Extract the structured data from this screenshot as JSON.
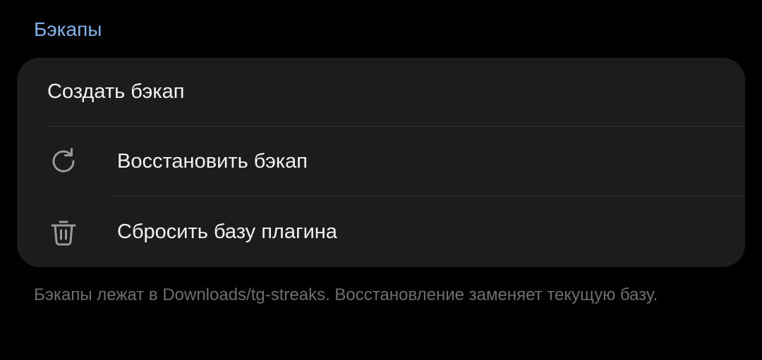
{
  "section": {
    "title": "Бэкапы"
  },
  "items": [
    {
      "label": "Создать бэкап",
      "icon": ""
    },
    {
      "label": "Восстановить бэкап",
      "icon": "refresh-icon"
    },
    {
      "label": "Сбросить базу плагина",
      "icon": "trash-icon"
    }
  ],
  "footer": {
    "note": "Бэкапы лежат в Downloads/tg-streaks. Восстановление заменяет текущую базу."
  },
  "colors": {
    "background": "#000000",
    "card": "#1c1c1c",
    "accent": "#7fb3e8",
    "text_primary": "#f2f2f2",
    "text_secondary": "#6e6e6e",
    "icon": "#9a9a9a"
  }
}
